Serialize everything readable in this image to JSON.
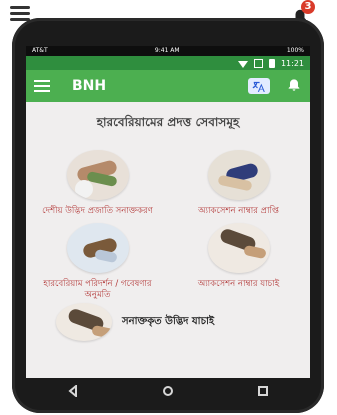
{
  "top_overlay": {
    "badge_count": "3"
  },
  "ios_status": {
    "carrier": "AT&T",
    "time": "9:41 AM",
    "battery": "100%"
  },
  "android_status": {
    "time": "11:21"
  },
  "app_bar": {
    "title": "BNH"
  },
  "main": {
    "heading": "হারবেরিয়ামের প্রদত্ত সেবাসমূহ",
    "cards": [
      {
        "label": "দেশীয় উদ্ভিদ প্রজাতি সনাক্তকরণ"
      },
      {
        "label": "অ্যাকসেশন নাম্বার প্রাপ্তি"
      },
      {
        "label": "হারবেরিয়াম পরিদর্শন / গবেষণার অনুমতি"
      },
      {
        "label": "অ্যাকসেশন নাম্বার যাচাই"
      }
    ],
    "last_item": {
      "label": "সনাক্তকৃত উদ্ভিদ যাচাই"
    }
  },
  "icons": {
    "menu": "hamburger-icon",
    "bell": "bell-icon",
    "translate": "translate-icon",
    "back": "back-triangle-icon",
    "home": "home-circle-icon",
    "recent": "recent-square-icon"
  },
  "colors": {
    "app_bar": "#4caf50",
    "status_bar": "#2f8e3e",
    "label_text": "#b33a3a",
    "badge": "#d93b2a"
  }
}
